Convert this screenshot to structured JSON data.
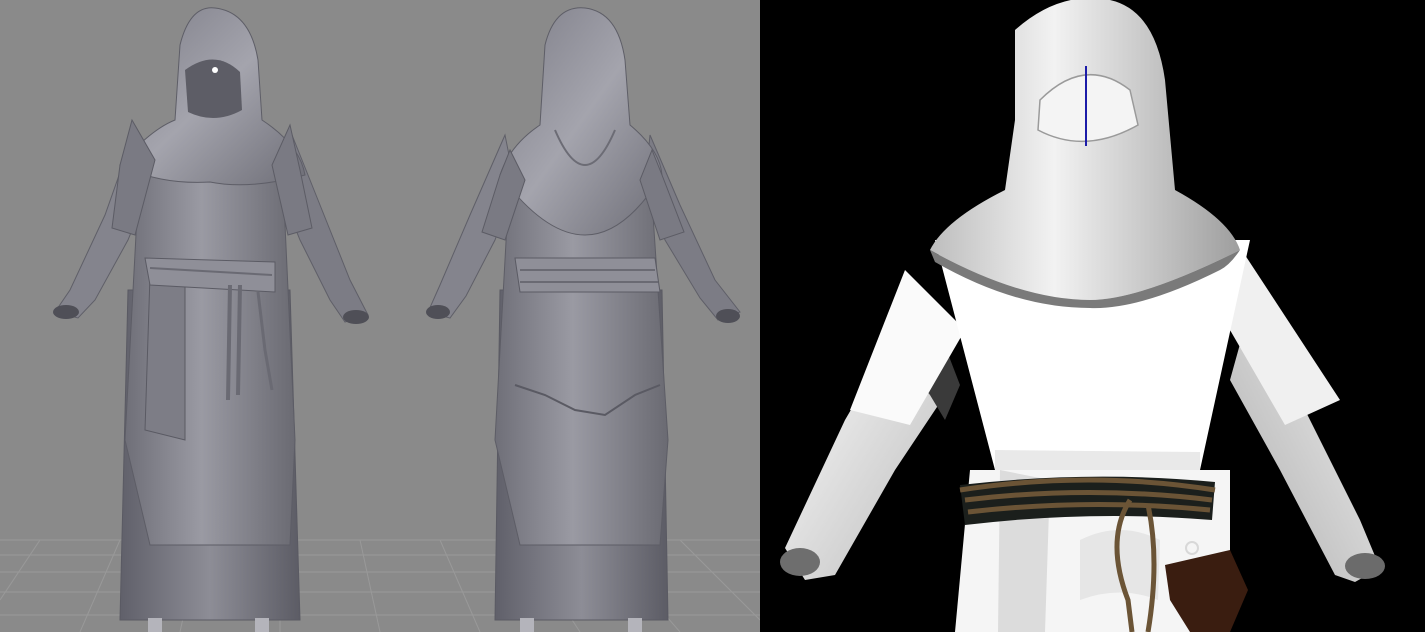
{
  "scene": {
    "left_viewport": {
      "background": "#8a8a8a",
      "grid_color": "#9c9c9c",
      "model_color": "#8c8c95",
      "views": [
        "front",
        "back"
      ]
    },
    "right_viewport": {
      "background": "#000000",
      "cloth_color": "#ffffff",
      "belt_color": "#1b1f1c",
      "rope_color": "#6b5436",
      "fur_color": "#3a3a3a",
      "seam_line_color": "#1c1ca8"
    }
  }
}
